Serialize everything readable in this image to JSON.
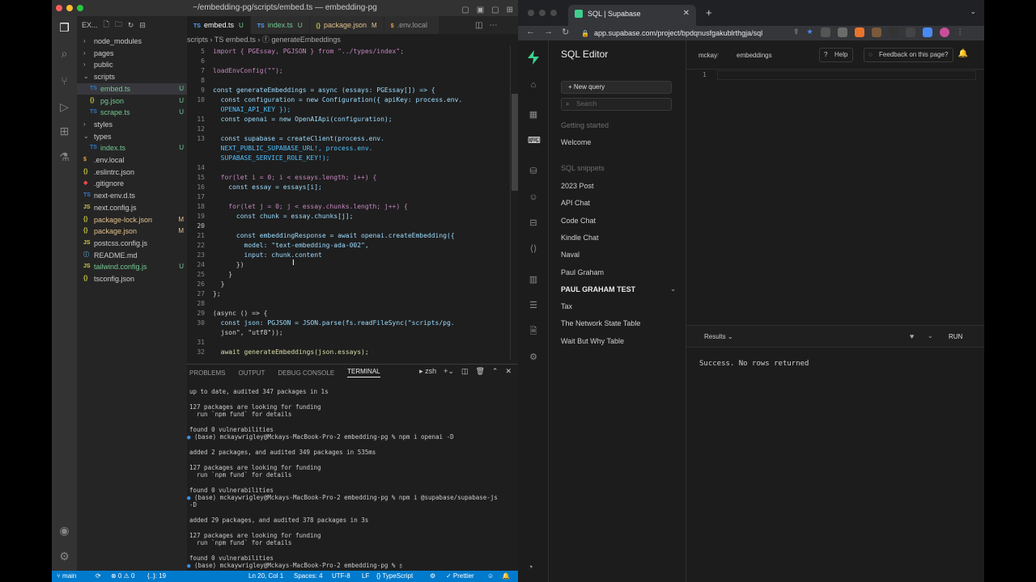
{
  "vscode": {
    "title": "~/embedding-pg/scripts/embed.ts — embedding-pg",
    "explorer_label": "EX...",
    "tree": [
      {
        "name": "node_modules",
        "type": "folder",
        "open": false,
        "depth": 1,
        "status": "",
        "icon": ""
      },
      {
        "name": "pages",
        "type": "folder",
        "open": false,
        "depth": 1,
        "status": "",
        "icon": ""
      },
      {
        "name": "public",
        "type": "folder",
        "open": false,
        "depth": 1,
        "status": "",
        "icon": ""
      },
      {
        "name": "scripts",
        "type": "folder",
        "open": true,
        "depth": 1,
        "status": "",
        "icon": ""
      },
      {
        "name": "embed.ts",
        "type": "file",
        "depth": 2,
        "status": "U",
        "icon": "TS"
      },
      {
        "name": "pg.json",
        "type": "file",
        "depth": 2,
        "status": "U",
        "icon": "{}"
      },
      {
        "name": "scrape.ts",
        "type": "file",
        "depth": 2,
        "status": "U",
        "icon": "TS"
      },
      {
        "name": "styles",
        "type": "folder",
        "open": false,
        "depth": 1,
        "status": "",
        "icon": ""
      },
      {
        "name": "types",
        "type": "folder",
        "open": true,
        "depth": 1,
        "status": "",
        "icon": ""
      },
      {
        "name": "index.ts",
        "type": "file",
        "depth": 2,
        "status": "U",
        "icon": "TS"
      },
      {
        "name": ".env.local",
        "type": "file",
        "depth": 1,
        "status": "",
        "icon": "$"
      },
      {
        "name": ".eslintrc.json",
        "type": "file",
        "depth": 1,
        "status": "",
        "icon": "{}"
      },
      {
        "name": ".gitignore",
        "type": "file",
        "depth": 1,
        "status": "",
        "icon": "◆"
      },
      {
        "name": "next-env.d.ts",
        "type": "file",
        "depth": 1,
        "status": "",
        "icon": "TS"
      },
      {
        "name": "next.config.js",
        "type": "file",
        "depth": 1,
        "status": "",
        "icon": "JS"
      },
      {
        "name": "package-lock.json",
        "type": "file",
        "depth": 1,
        "status": "M",
        "icon": "{}"
      },
      {
        "name": "package.json",
        "type": "file",
        "depth": 1,
        "status": "M",
        "icon": "{}"
      },
      {
        "name": "postcss.config.js",
        "type": "file",
        "depth": 1,
        "status": "",
        "icon": "JS"
      },
      {
        "name": "README.md",
        "type": "file",
        "depth": 1,
        "status": "",
        "icon": "ⓘ"
      },
      {
        "name": "tailwind.config.js",
        "type": "file",
        "depth": 1,
        "status": "U",
        "icon": "JS"
      },
      {
        "name": "tsconfig.json",
        "type": "file",
        "depth": 1,
        "status": "",
        "icon": "{}"
      }
    ],
    "tabs": [
      {
        "ext": "TS",
        "label": "embed.ts",
        "status": "U",
        "active": true
      },
      {
        "ext": "TS",
        "label": "index.ts",
        "status": "U",
        "active": false
      },
      {
        "ext": "{}",
        "label": "package.json",
        "status": "M",
        "active": false
      },
      {
        "ext": "$",
        "label": ".env.local",
        "status": "",
        "active": false
      }
    ],
    "breadcrumb": "scripts › TS embed.ts › ⓕ generateEmbeddings",
    "code": [
      {
        "n": "5",
        "text": "import { PGEssay, PGJSON } from \"../types/index\";"
      },
      {
        "n": "6",
        "text": ""
      },
      {
        "n": "7",
        "text": "loadEnvConfig(\"\");"
      },
      {
        "n": "8",
        "text": ""
      },
      {
        "n": "9",
        "text": "const generateEmbeddings = async (essays: PGEssay[]) => {"
      },
      {
        "n": "10",
        "text": "  const configuration = new Configuration({ apiKey: process.env."
      },
      {
        "n": "",
        "text": "  OPENAI_API_KEY });"
      },
      {
        "n": "11",
        "text": "  const openai = new OpenAIApi(configuration);"
      },
      {
        "n": "12",
        "text": ""
      },
      {
        "n": "13",
        "text": "  const supabase = createClient(process.env."
      },
      {
        "n": "",
        "text": "  NEXT_PUBLIC_SUPABASE_URL!, process.env."
      },
      {
        "n": "",
        "text": "  SUPABASE_SERVICE_ROLE_KEY!);"
      },
      {
        "n": "14",
        "text": ""
      },
      {
        "n": "15",
        "text": "  for(let i = 0; i < essays.length; i++) {"
      },
      {
        "n": "16",
        "text": "    const essay = essays[i];"
      },
      {
        "n": "17",
        "text": ""
      },
      {
        "n": "18",
        "text": "    for(let j = 0; j < essay.chunks.length; j++) {"
      },
      {
        "n": "19",
        "text": "      const chunk = essay.chunks[j];"
      },
      {
        "n": "20",
        "text": ""
      },
      {
        "n": "21",
        "text": "      const embeddingResponse = await openai.createEmbedding({"
      },
      {
        "n": "22",
        "text": "        model: \"text-embedding-ada-002\","
      },
      {
        "n": "23",
        "text": "        input: chunk.content"
      },
      {
        "n": "24",
        "text": "      })"
      },
      {
        "n": "25",
        "text": "    }"
      },
      {
        "n": "26",
        "text": "  }"
      },
      {
        "n": "27",
        "text": "};"
      },
      {
        "n": "28",
        "text": ""
      },
      {
        "n": "29",
        "text": "(async () => {"
      },
      {
        "n": "30",
        "text": "  const json: PGJSON = JSON.parse(fs.readFileSync(\"scripts/pg."
      },
      {
        "n": "",
        "text": "  json\", \"utf8\"));"
      },
      {
        "n": "31",
        "text": ""
      },
      {
        "n": "32",
        "text": "  await generateEmbeddings(json.essays);"
      }
    ],
    "panel_tabs": [
      "PROBLEMS",
      "OUTPUT",
      "DEBUG CONSOLE",
      "TERMINAL"
    ],
    "terminal_shell": "zsh",
    "terminal": [
      {
        "dot": false,
        "text": "up to date, audited 347 packages in 1s"
      },
      {
        "dot": false,
        "text": ""
      },
      {
        "dot": false,
        "text": "127 packages are looking for funding"
      },
      {
        "dot": false,
        "text": "  run `npm fund` for details"
      },
      {
        "dot": false,
        "text": ""
      },
      {
        "dot": false,
        "text": "found 0 vulnerabilities"
      },
      {
        "dot": true,
        "text": "(base) mckaywrigley@Mckays-MacBook-Pro-2 embedding-pg % npm i openai -D"
      },
      {
        "dot": false,
        "text": ""
      },
      {
        "dot": false,
        "text": "added 2 packages, and audited 349 packages in 535ms"
      },
      {
        "dot": false,
        "text": ""
      },
      {
        "dot": false,
        "text": "127 packages are looking for funding"
      },
      {
        "dot": false,
        "text": "  run `npm fund` for details"
      },
      {
        "dot": false,
        "text": ""
      },
      {
        "dot": false,
        "text": "found 0 vulnerabilities"
      },
      {
        "dot": true,
        "text": "(base) mckaywrigley@Mckays-MacBook-Pro-2 embedding-pg % npm i @supabase/supabase-js"
      },
      {
        "dot": false,
        "text": "-D"
      },
      {
        "dot": false,
        "text": ""
      },
      {
        "dot": false,
        "text": "added 29 packages, and audited 378 packages in 3s"
      },
      {
        "dot": false,
        "text": ""
      },
      {
        "dot": false,
        "text": "127 packages are looking for funding"
      },
      {
        "dot": false,
        "text": "  run `npm fund` for details"
      },
      {
        "dot": false,
        "text": ""
      },
      {
        "dot": false,
        "text": "found 0 vulnerabilities"
      },
      {
        "dot": true,
        "text": "(base) mckaywrigley@Mckays-MacBook-Pro-2 embedding-pg % ▯"
      }
    ],
    "status": {
      "branch": "main",
      "sync": "⟳",
      "problems": "⊗ 0 ⚠ 0",
      "symbols": "{..}: 19",
      "cursor": "Ln 20, Col 1",
      "spaces": "Spaces: 4",
      "encoding": "UTF-8",
      "eol": "LF",
      "language": "{} TypeScript",
      "prettier": "✓ Prettier"
    }
  },
  "browser": {
    "tab_title": "SQL | Supabase",
    "url": "app.supabase.com/project/bpdqnusfgakublrthgja/sql",
    "supabase": {
      "sidebar_title": "SQL Editor",
      "new_query": "+  New query",
      "search_placeholder": "Search",
      "section_getting_started": "Getting started",
      "welcome": "Welcome",
      "section_snippets": "SQL snippets",
      "snippets": [
        "2023 Post",
        "API Chat",
        "Code Chat",
        "Kindle Chat",
        "Naval",
        "Paul Graham",
        "PAUL GRAHAM TEST",
        "Tax",
        "The Network State Table",
        "Wait But Why Table"
      ],
      "crumb_org": "mckay",
      "crumb_project": "embeddings",
      "help": "Help",
      "feedback": "Feedback on this page?",
      "editor_line": "1",
      "results_label": "Results",
      "run_label": "RUN",
      "result_message": "Success. No rows returned"
    }
  }
}
